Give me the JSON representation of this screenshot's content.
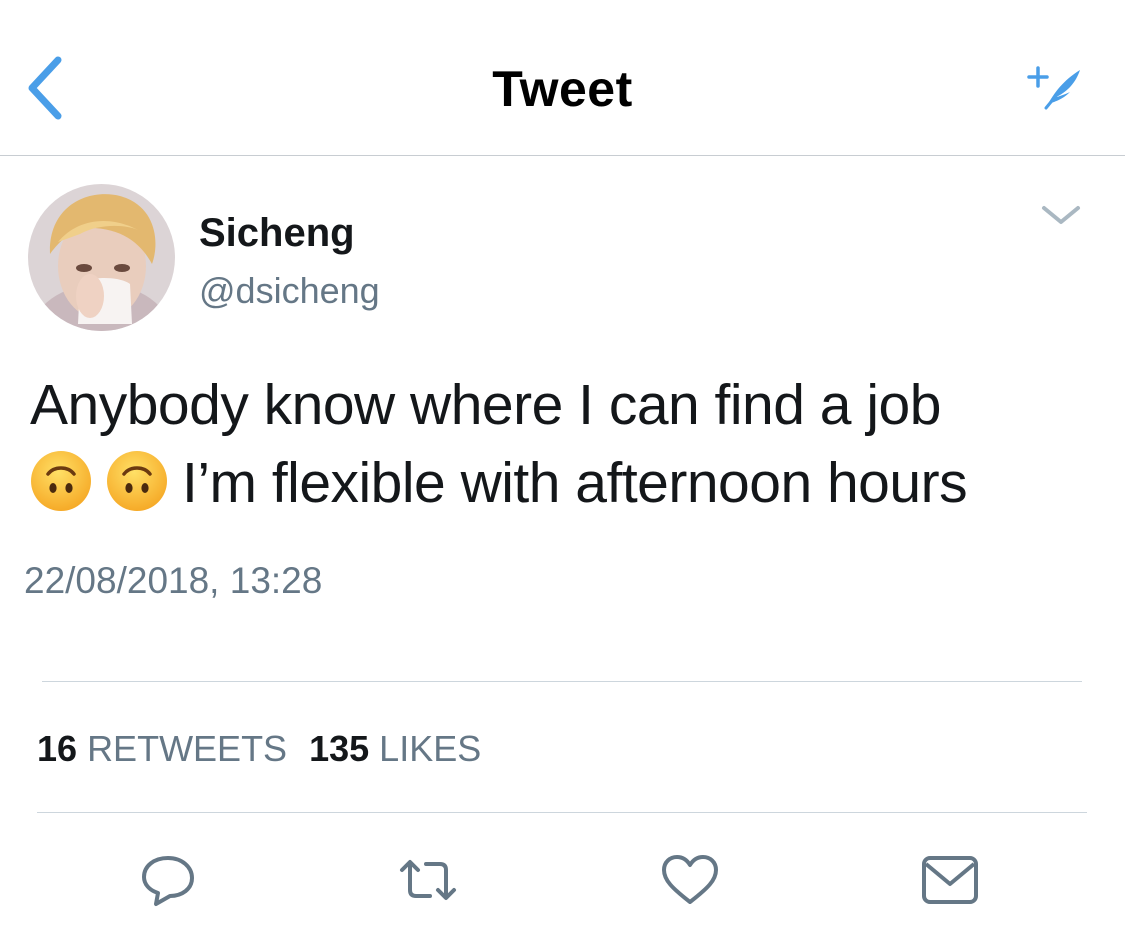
{
  "nav": {
    "title": "Tweet",
    "back_icon": "chevron-left-icon",
    "compose_icon": "compose-sparkle-feather-icon",
    "accent_color": "#4a9ee8"
  },
  "tweet": {
    "author": {
      "display_name": "Sicheng",
      "handle": "@dsicheng"
    },
    "text_line_1": "Anybody know where I can find a job",
    "text_line_2": "I’m flexible with afternoon hours",
    "emojis": [
      "upside-down-face-emoji",
      "upside-down-face-emoji"
    ],
    "timestamp": "22/08/2018, 13:28",
    "stats": {
      "retweets_count": "16",
      "retweets_label": "RETWEETS",
      "likes_count": "135",
      "likes_label": "LIKES"
    }
  },
  "actions": {
    "icons": [
      "reply-icon",
      "retweet-icon",
      "like-icon",
      "share-mail-icon"
    ],
    "icon_color": "#657786"
  }
}
